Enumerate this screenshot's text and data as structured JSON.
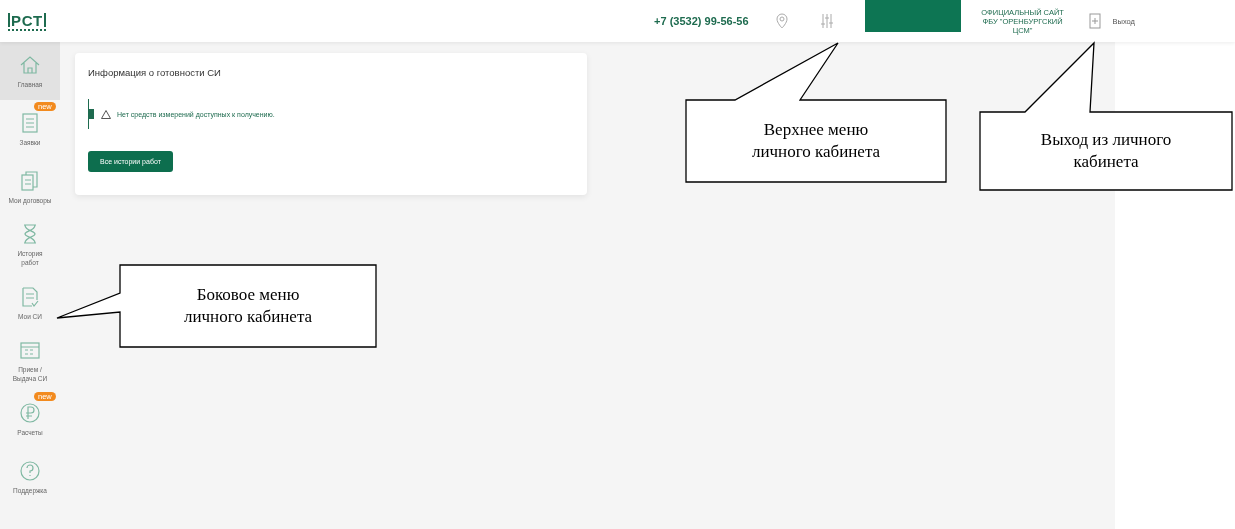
{
  "header": {
    "logo": "РСТ",
    "phone": "+7 (3532) 99-56-56",
    "official_site": [
      "ОФИЦИАЛЬНЫЙ САЙТ",
      "ФБУ \"ОРЕНБУРГСКИЙ",
      "ЦСМ\""
    ],
    "logout": "Выход"
  },
  "sidebar": {
    "items": [
      {
        "label": "Главная",
        "selected": true
      },
      {
        "label": "Заявки",
        "selected": false,
        "badge": "new"
      },
      {
        "label": "Мои договоры",
        "selected": false
      },
      {
        "label": "История работ",
        "selected": false
      },
      {
        "label": "Мои СИ",
        "selected": false
      },
      {
        "label": "Прием / Выдача СИ",
        "selected": false
      },
      {
        "label": "Расчеты",
        "selected": false,
        "badge": "new"
      },
      {
        "label": "Поддержка",
        "selected": false
      }
    ]
  },
  "card": {
    "title": "Информация о готовности СИ",
    "alert": "Нет средств измерений доступных к получению.",
    "button": "Все истории работ"
  },
  "callouts": [
    {
      "kind": "left",
      "text": "Боковое меню личного кабинета"
    },
    {
      "kind": "up",
      "text": "Верхнее меню личного кабинета"
    },
    {
      "kind": "up2",
      "text": "Выход из личного кабинета"
    }
  ]
}
